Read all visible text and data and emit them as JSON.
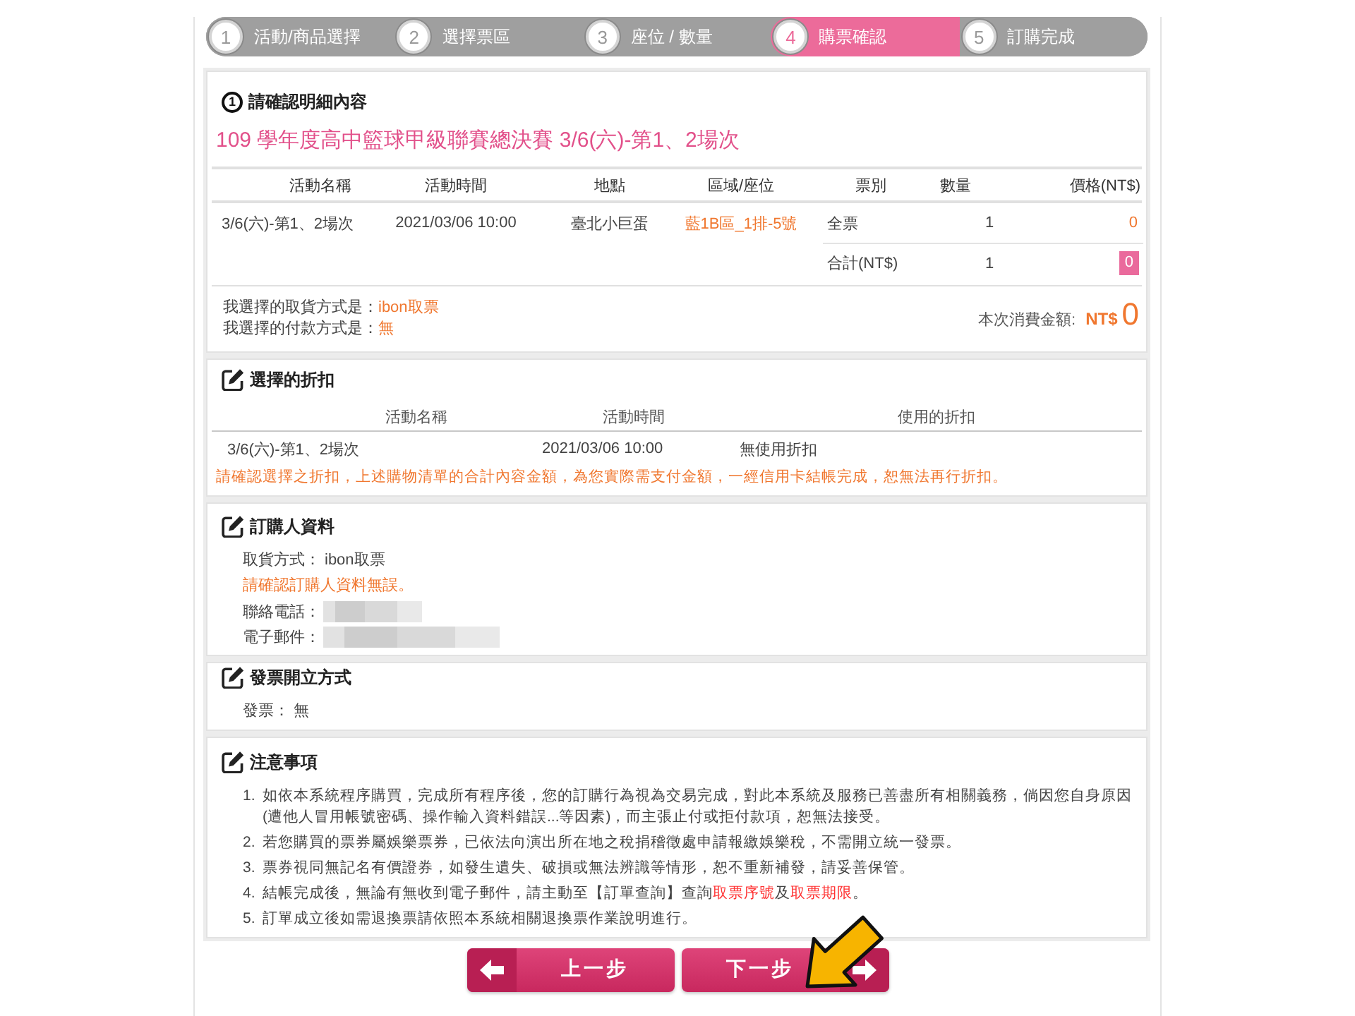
{
  "steps": [
    {
      "number": "1",
      "label": "活動/商品選擇",
      "selected": false
    },
    {
      "number": "2",
      "label": "選擇票區",
      "selected": false
    },
    {
      "number": "3",
      "label": "座位 / 數量",
      "selected": false
    },
    {
      "number": "4",
      "label": "購票確認",
      "selected": true
    },
    {
      "number": "5",
      "label": "訂購完成",
      "selected": false
    }
  ],
  "order_details": {
    "heading_number": "1",
    "heading": "請確認明細內容",
    "event_title": "109 學年度高中籃球甲級聯賽總決賽 3/6(六)-第1、2場次",
    "columns": [
      "活動名稱",
      "活動時間",
      "地點",
      "區域/座位",
      "票別",
      "數量",
      "價格(NT$)"
    ],
    "rows": [
      {
        "event": "3/6(六)-第1、2場次",
        "time": "2021/03/06 10:00",
        "venue": "臺北小巨蛋",
        "seat": "藍1B區_1排-5號",
        "ticket_type": "全票",
        "quantity": "1",
        "price": "0"
      }
    ],
    "total": {
      "label": "合計(NT$)",
      "quantity": "1",
      "price": "0"
    },
    "pickup": {
      "label": "我選擇的取貨方式是：",
      "value": "ibon取票"
    },
    "payment": {
      "label": "我選擇的付款方式是：",
      "value": "無"
    },
    "amount": {
      "label": "本次消費金額:",
      "currency": "NT$",
      "value": "0"
    }
  },
  "discount": {
    "heading": "選擇的折扣",
    "columns": [
      "活動名稱",
      "活動時間",
      "使用的折扣"
    ],
    "rows": [
      {
        "event": "3/6(六)-第1、2場次",
        "time": "2021/03/06 10:00",
        "discount": "無使用折扣"
      }
    ],
    "note": "請確認選擇之折扣，上述購物清單的合計內容金額，為您實際需支付金額，一經信用卡結帳完成，恕無法再行折扣。"
  },
  "purchaser": {
    "heading": "訂購人資料",
    "fields": [
      {
        "kind": "text",
        "label": "取貨方式：",
        "value": "ibon取票"
      },
      {
        "kind": "notice",
        "text": "請確認訂購人資料無誤。"
      },
      {
        "kind": "redacted",
        "label": "聯絡電話："
      },
      {
        "kind": "redacted",
        "label": "電子郵件："
      }
    ]
  },
  "invoice": {
    "heading": "發票開立方式",
    "fields": [
      {
        "kind": "text",
        "label": "發票：",
        "value": "無"
      }
    ]
  },
  "notes": {
    "heading": "注意事項",
    "items": [
      {
        "number": "1.",
        "parts": [
          {
            "text": "如依本系統程序購買，完成所有程序後，您的訂購行為視為交易完成，對此本系統及服務已善盡所有相關義務，倘因您自身原因(遭他人冒用帳號密碼、操作輸入資料錯誤...等因素)，而主張止付或拒付款項，恕無法接受。",
            "highlight": false
          }
        ]
      },
      {
        "number": "2.",
        "parts": [
          {
            "text": "若您購買的票券屬娛樂票券，已依法向演出所在地之稅捐稽徵處申請報繳娛樂稅，不需開立統一發票。",
            "highlight": false
          }
        ]
      },
      {
        "number": "3.",
        "parts": [
          {
            "text": "票券視同無記名有價證券，如發生遺失、破損或無法辨識等情形，恕不重新補發，請妥善保管。",
            "highlight": false
          }
        ]
      },
      {
        "number": "4.",
        "parts": [
          {
            "text": "結帳完成後，無論有無收到電子郵件，請主動至【訂單查詢】查詢",
            "highlight": false
          },
          {
            "text": "取票序號",
            "highlight": true
          },
          {
            "text": "及",
            "highlight": false
          },
          {
            "text": "取票期限",
            "highlight": true
          },
          {
            "text": "。",
            "highlight": false
          }
        ]
      },
      {
        "number": "5.",
        "parts": [
          {
            "text": "訂單成立後如需退換票請依照本系統相關退換票作業說明進行。",
            "highlight": false
          }
        ]
      }
    ]
  },
  "buttons": [
    {
      "kind": "back",
      "label": "上一步"
    },
    {
      "kind": "next",
      "label": "下一步"
    }
  ]
}
